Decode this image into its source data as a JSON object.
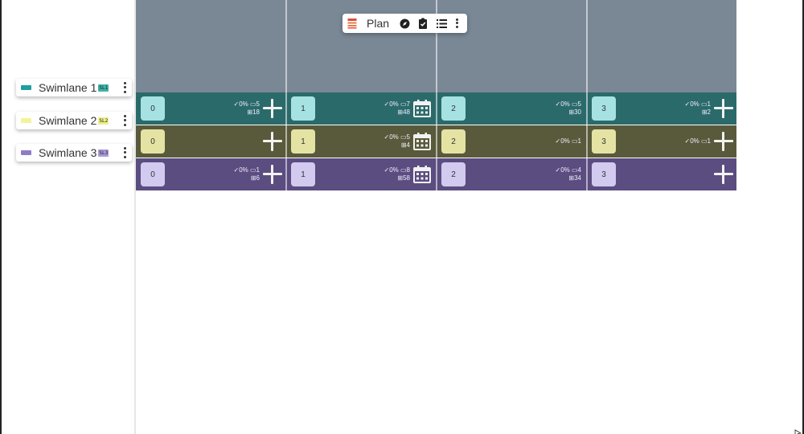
{
  "toolbar": {
    "title": "Plan"
  },
  "colors": {
    "header": "#7a8896",
    "lane1": "#2b6a6a",
    "lane2": "#595a3b",
    "lane3": "#5b4d80"
  },
  "swimlanes": [
    {
      "name": "Swimlane 1",
      "badge": "SL1",
      "swatch": "#1f9e9e",
      "badge_color": "#3fb3a8",
      "row_color": "#2b6a6a",
      "bubble_color": "#a7e2e3"
    },
    {
      "name": "Swimlane 2",
      "badge": "SL2",
      "swatch": "#f5f39a",
      "badge_color": "#eeee8c",
      "row_color": "#595a3b",
      "bubble_color": "#e4e3a4"
    },
    {
      "name": "Swimlane 3",
      "badge": "SL3",
      "swatch": "#8f7cc8",
      "badge_color": "#a99ad8",
      "row_color": "#5b4d80",
      "bubble_color": "#d3caef"
    }
  ],
  "cells": [
    [
      {
        "n": "0",
        "l1": "✓0% ▭5",
        "l2": "⊞18",
        "action": "plus"
      },
      {
        "n": "1",
        "l1": "✓0% ▭7",
        "l2": "⊞48",
        "action": "calendar"
      },
      {
        "n": "2",
        "l1": "✓0% ▭5",
        "l2": "⊞30",
        "action": "none"
      },
      {
        "n": "3",
        "l1": "✓0% ▭1",
        "l2": "⊞2",
        "action": "plus"
      }
    ],
    [
      {
        "n": "0",
        "l1": "",
        "l2": "",
        "action": "plus"
      },
      {
        "n": "1",
        "l1": "✓0% ▭5",
        "l2": "⊞4",
        "action": "calendar"
      },
      {
        "n": "2",
        "l1": "✓0% ▭1",
        "l2": "",
        "action": "none"
      },
      {
        "n": "3",
        "l1": "✓0% ▭1",
        "l2": "",
        "action": "plus"
      }
    ],
    [
      {
        "n": "0",
        "l1": "✓0% ▭1",
        "l2": "⊞6",
        "action": "plus"
      },
      {
        "n": "1",
        "l1": "✓0% ▭8",
        "l2": "⊞58",
        "action": "calendar"
      },
      {
        "n": "2",
        "l1": "✓0% ▭4",
        "l2": "⊞34",
        "action": "none"
      },
      {
        "n": "3",
        "l1": "",
        "l2": "",
        "action": "plus"
      }
    ]
  ]
}
